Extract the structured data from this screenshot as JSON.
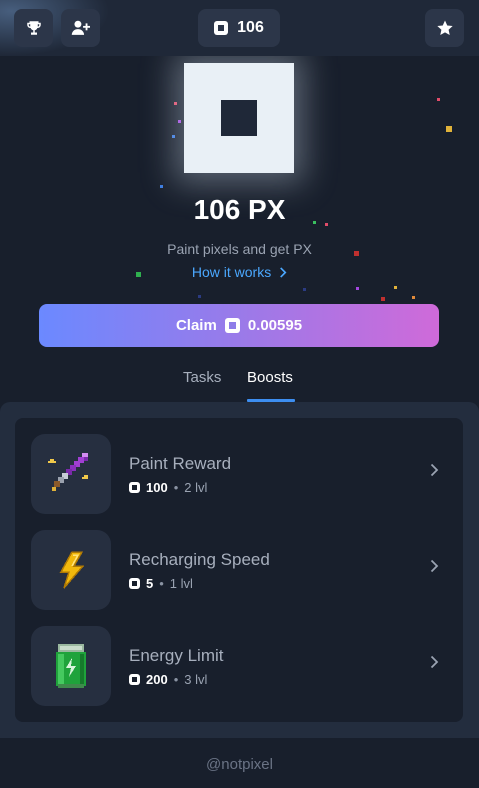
{
  "header": {
    "balance": "106",
    "icons": [
      "trophy-icon",
      "add-user-icon",
      "pixel-coin-icon",
      "star-icon"
    ]
  },
  "hero": {
    "title": "106 PX",
    "subtitle": "Paint pixels and get PX",
    "how_link": "How it works"
  },
  "claim": {
    "label": "Claim",
    "amount": "0.00595"
  },
  "tabs": [
    {
      "label": "Tasks",
      "active": false
    },
    {
      "label": "Boosts",
      "active": true
    }
  ],
  "boosts": [
    {
      "name": "Paint Reward",
      "cost": "100",
      "level": "2 lvl",
      "icon": "paintbrush-icon"
    },
    {
      "name": "Recharging Speed",
      "cost": "5",
      "level": "1 lvl",
      "icon": "lightning-icon"
    },
    {
      "name": "Energy Limit",
      "cost": "200",
      "level": "3 lvl",
      "icon": "battery-icon"
    }
  ],
  "footer": {
    "handle": "@notpixel"
  },
  "colors": {
    "accent": "#3d8ef0",
    "link": "#4ba8ff",
    "claim_start": "#6b89ff",
    "claim_end": "#cf6ad9",
    "background": "#181f2c"
  }
}
